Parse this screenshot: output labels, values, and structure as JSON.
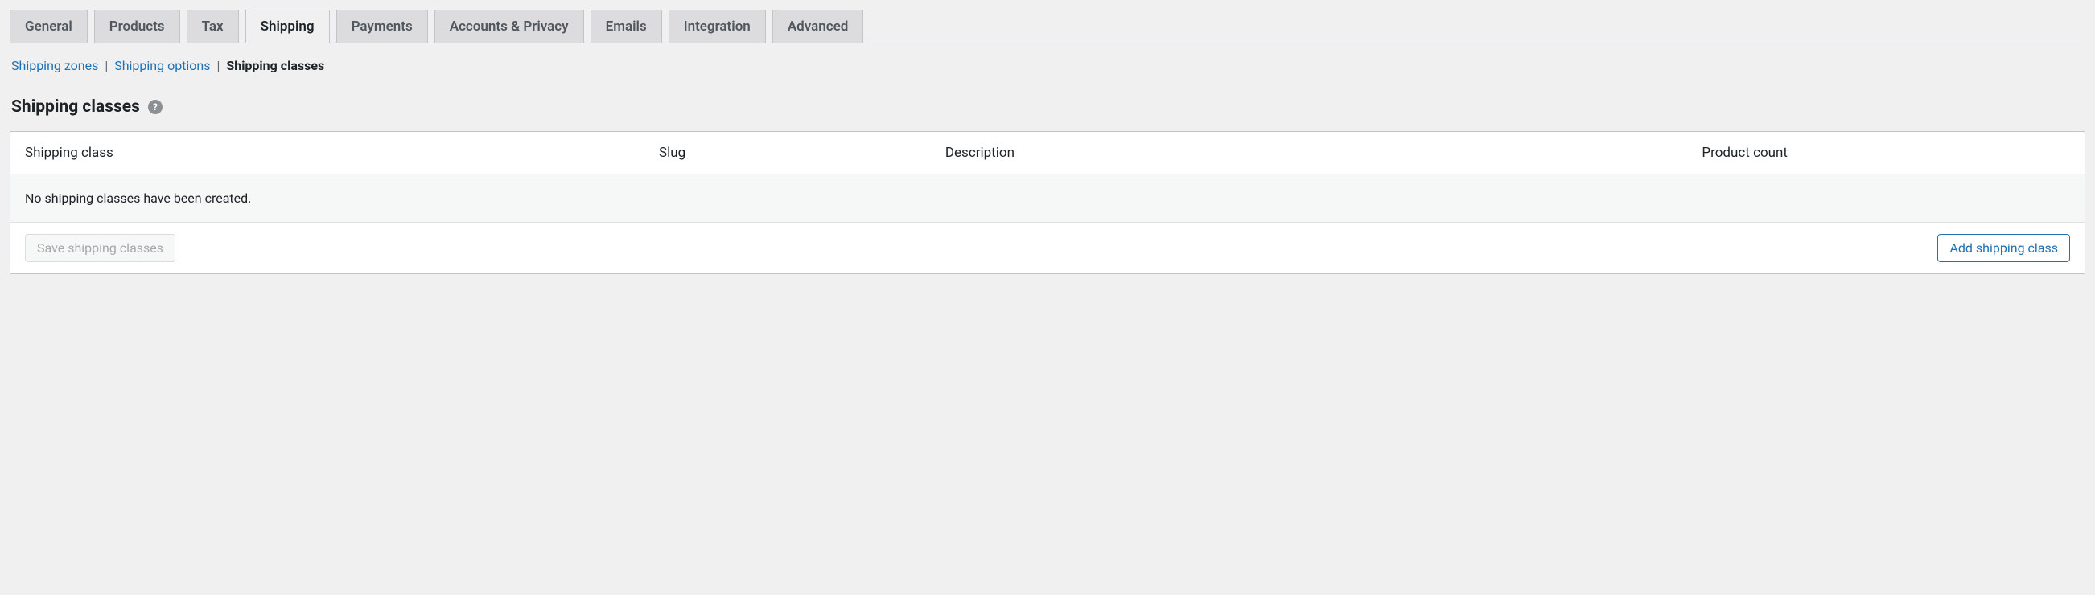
{
  "tabs": [
    {
      "label": "General"
    },
    {
      "label": "Products"
    },
    {
      "label": "Tax"
    },
    {
      "label": "Shipping",
      "active": true
    },
    {
      "label": "Payments"
    },
    {
      "label": "Accounts & Privacy"
    },
    {
      "label": "Emails"
    },
    {
      "label": "Integration"
    },
    {
      "label": "Advanced"
    }
  ],
  "subnav": {
    "zones": "Shipping zones",
    "options": "Shipping options",
    "classes": "Shipping classes"
  },
  "heading": "Shipping classes",
  "table": {
    "headers": {
      "class": "Shipping class",
      "slug": "Slug",
      "description": "Description",
      "count": "Product count"
    },
    "empty": "No shipping classes have been created."
  },
  "buttons": {
    "save": "Save shipping classes",
    "add": "Add shipping class"
  }
}
